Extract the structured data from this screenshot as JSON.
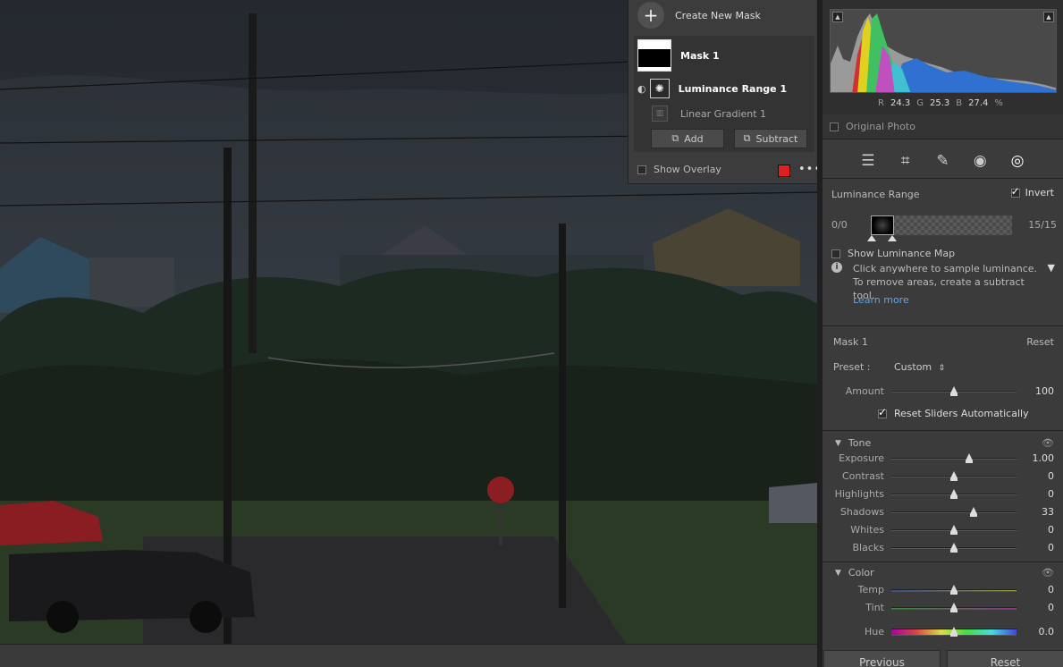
{
  "mask_panel": {
    "create_label": "Create New Mask",
    "mask_name": "Mask 1",
    "sub1": "Luminance Range 1",
    "sub2": "Linear Gradient 1",
    "add_label": "Add",
    "subtract_label": "Subtract",
    "show_overlay": "Show Overlay",
    "overlay_color": "#e02020"
  },
  "histogram": {
    "r_label": "R",
    "r_value": "24.3",
    "g_label": "G",
    "g_value": "25.3",
    "b_label": "B",
    "b_value": "27.4",
    "pct": "%",
    "original_photo": "Original Photo"
  },
  "toolbar": {
    "icons": [
      "edit-sliders-icon",
      "crop-icon",
      "healing-icon",
      "redeye-icon",
      "masking-icon"
    ]
  },
  "luminance": {
    "title": "Luminance Range",
    "invert_label": "Invert",
    "invert_checked": true,
    "left_value": "0/0",
    "right_value": "15/15",
    "show_map": "Show Luminance Map",
    "info": "Click anywhere to sample luminance. To remove areas, create a subtract tool.",
    "learn_more": "Learn more"
  },
  "mask_settings": {
    "title": "Mask 1",
    "reset": "Reset",
    "preset_label": "Preset :",
    "preset_value": "Custom",
    "amount_label": "Amount",
    "amount_value": "100",
    "amount_level": 0.5,
    "reset_sliders": "Reset Sliders Automatically"
  },
  "tone": {
    "title": "Tone",
    "sliders": [
      {
        "label": "Exposure",
        "value": "1.00",
        "level": 0.62
      },
      {
        "label": "Contrast",
        "value": "0",
        "level": 0.5
      },
      {
        "label": "Highlights",
        "value": "0",
        "level": 0.5
      },
      {
        "label": "Shadows",
        "value": "33",
        "level": 0.66
      },
      {
        "label": "Whites",
        "value": "0",
        "level": 0.5
      },
      {
        "label": "Blacks",
        "value": "0",
        "level": 0.5
      }
    ]
  },
  "color": {
    "title": "Color",
    "sliders": [
      {
        "label": "Temp",
        "value": "0",
        "level": 0.5
      },
      {
        "label": "Tint",
        "value": "0",
        "level": 0.5
      },
      {
        "label": "Hue",
        "value": "0.0",
        "level": 0.5
      }
    ]
  },
  "footer": {
    "previous": "Previous",
    "reset": "Reset"
  }
}
